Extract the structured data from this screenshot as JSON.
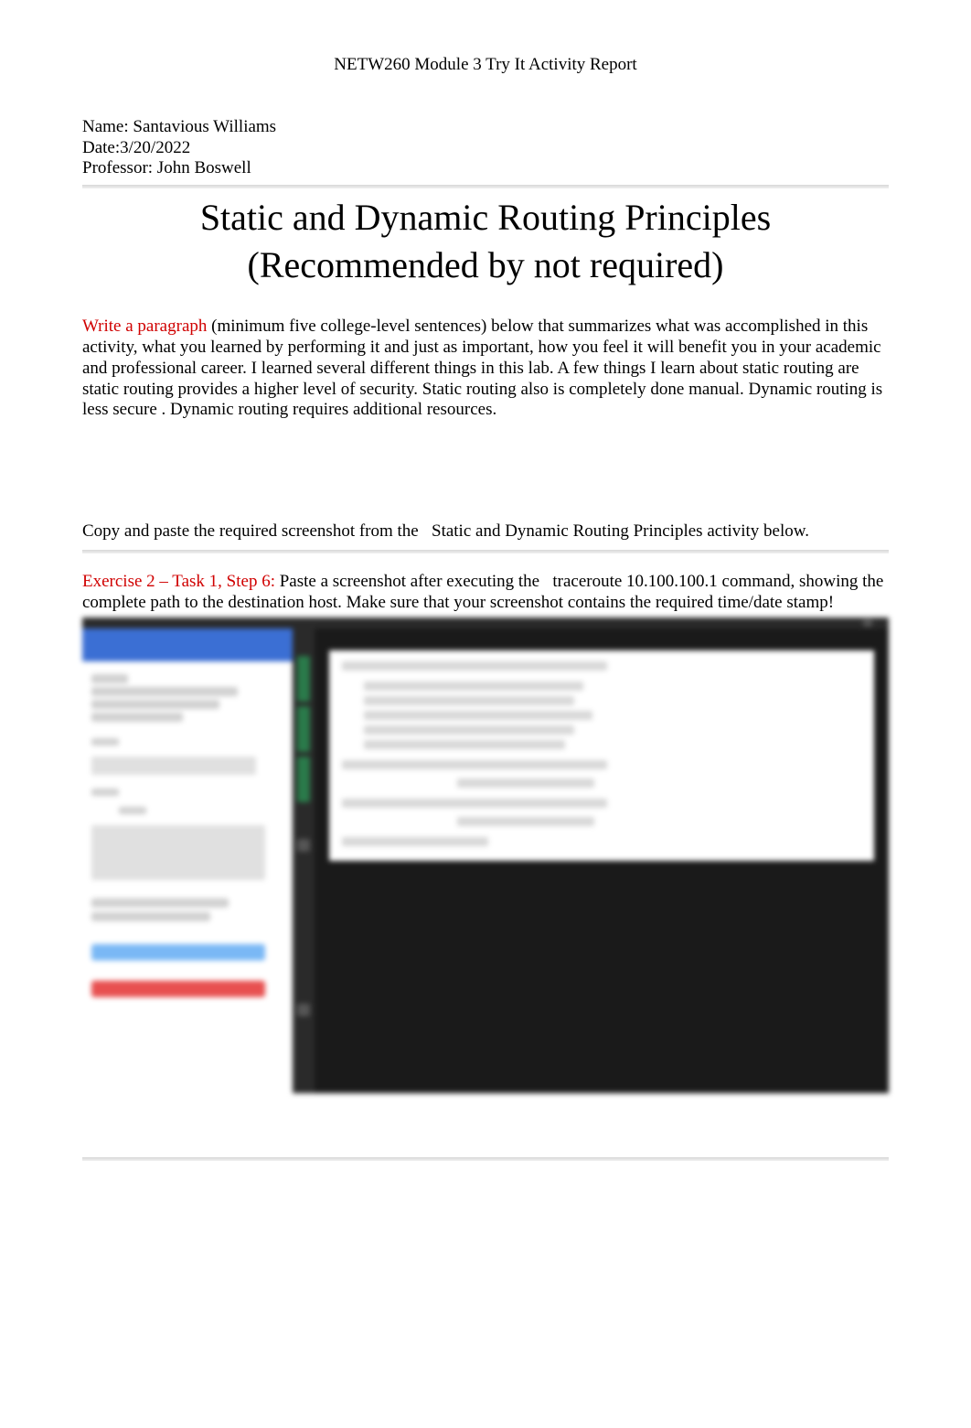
{
  "header": {
    "title": "NETW260 Module 3 Try It Activity Report"
  },
  "meta": {
    "name_label": "Name: Santavious Williams",
    "date_label": "Date:3/20/2022",
    "professor_label": "Professor: John Boswell"
  },
  "main_title": "Static and Dynamic Routing Principles (Recommended by not required)",
  "paragraph": {
    "prompt": "Write a paragraph",
    "body": "  (minimum five college-level sentences) below that summarizes what was accomplished in this activity, what you learned by performing it and just as important, how you feel it will benefit you in your academic and professional career.  I learned several different things in this lab. A few things I learn about static routing are static routing provides a higher level of security. Static routing also is completely done manual. Dynamic routing is less secure . Dynamic routing     requires additional resources."
  },
  "instruction": {
    "prefix": "Copy and paste the required screenshot from the ",
    "activity_name": "Static and Dynamic Routing Principles",
    "suffix": " activity below."
  },
  "exercise": {
    "label": "Exercise 2 – Task 1, Step 6:",
    "text_before": " Paste a screenshot after executing the ",
    "command": "traceroute 10.100.100.1",
    "text_after": "   command, showing the complete path to the destination host. Make sure that your screenshot contains the required time/date stamp!"
  }
}
